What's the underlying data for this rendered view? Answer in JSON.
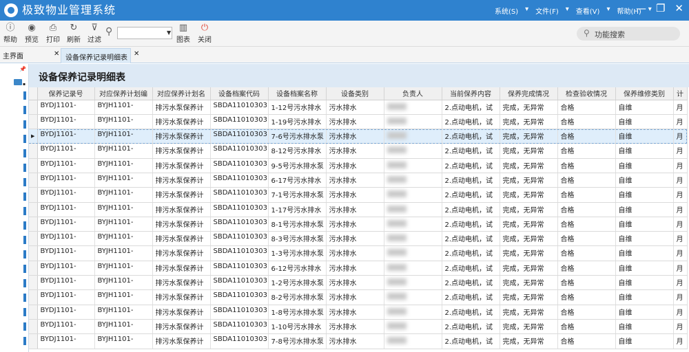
{
  "app": {
    "title": "极致物业管理系统"
  },
  "menu": [
    "系统(S)",
    "文件(F)",
    "查看(V)",
    "帮助(H)"
  ],
  "window_icons": [
    "minimize-icon",
    "restore-icon",
    "close-icon"
  ],
  "toolbar": {
    "help": "帮助",
    "preview": "预览",
    "print": "打印",
    "refresh": "刷新",
    "filter": "过滤",
    "chart": "图表",
    "close": "关闭",
    "search_value": "",
    "function_search": "功能搜索"
  },
  "tabs": {
    "home": "主界面",
    "active": "设备保养记录明细表"
  },
  "page": {
    "heading": "设备保养记录明细表"
  },
  "table": {
    "columns": [
      "保养记录号",
      "对应保养计划编",
      "对应保养计划名",
      "设备档案代码",
      "设备档案名称",
      "设备类别",
      "负责人",
      "当前保养内容",
      "保养完成情况",
      "检查验收情况",
      "保养维修类别",
      "计"
    ],
    "selected_row": 2,
    "rows": [
      [
        "BYDJ1101-",
        "BYJH1101-",
        "排污水泵保养计",
        "SBDA11010303",
        "1-12号污水排水",
        "污水排水",
        "",
        "2.点动电机，试",
        "完成，无异常",
        "合格",
        "自维",
        "月"
      ],
      [
        "BYDJ1101-",
        "BYJH1101-",
        "排污水泵保养计",
        "SBDA11010303",
        "1-19号污水排水",
        "污水排水",
        "",
        "2.点动电机，试",
        "完成，无异常",
        "合格",
        "自维",
        "月"
      ],
      [
        "BYDJ1101-",
        "BYJH1101-",
        "排污水泵保养计",
        "SBDA11010303",
        "7-6号污水排水泵",
        "污水排水",
        "",
        "2.点动电机，试",
        "完成，无异常",
        "合格",
        "自维",
        "月"
      ],
      [
        "BYDJ1101-",
        "BYJH1101-",
        "排污水泵保养计",
        "SBDA11010303",
        "8-12号污水排水",
        "污水排水",
        "",
        "2.点动电机，试",
        "完成，无异常",
        "合格",
        "自维",
        "月"
      ],
      [
        "BYDJ1101-",
        "BYJH1101-",
        "排污水泵保养计",
        "SBDA11010303",
        "9-5号污水排水泵",
        "污水排水",
        "",
        "2.点动电机，试",
        "完成，无异常",
        "合格",
        "自维",
        "月"
      ],
      [
        "BYDJ1101-",
        "BYJH1101-",
        "排污水泵保养计",
        "SBDA11010303",
        "6-17号污水排水",
        "污水排水",
        "",
        "2.点动电机，试",
        "完成，无异常",
        "合格",
        "自维",
        "月"
      ],
      [
        "BYDJ1101-",
        "BYJH1101-",
        "排污水泵保养计",
        "SBDA11010303",
        "7-1号污水排水泵",
        "污水排水",
        "",
        "2.点动电机，试",
        "完成，无异常",
        "合格",
        "自维",
        "月"
      ],
      [
        "BYDJ1101-",
        "BYJH1101-",
        "排污水泵保养计",
        "SBDA11010303",
        "1-17号污水排水",
        "污水排水",
        "",
        "2.点动电机，试",
        "完成，无异常",
        "合格",
        "自维",
        "月"
      ],
      [
        "BYDJ1101-",
        "BYJH1101-",
        "排污水泵保养计",
        "SBDA11010303",
        "8-1号污水排水泵",
        "污水排水",
        "",
        "2.点动电机，试",
        "完成，无异常",
        "合格",
        "自维",
        "月"
      ],
      [
        "BYDJ1101-",
        "BYJH1101-",
        "排污水泵保养计",
        "SBDA11010303",
        "8-3号污水排水泵",
        "污水排水",
        "",
        "2.点动电机，试",
        "完成，无异常",
        "合格",
        "自维",
        "月"
      ],
      [
        "BYDJ1101-",
        "BYJH1101-",
        "排污水泵保养计",
        "SBDA11010303",
        "1-3号污水排水泵",
        "污水排水",
        "",
        "2.点动电机，试",
        "完成，无异常",
        "合格",
        "自维",
        "月"
      ],
      [
        "BYDJ1101-",
        "BYJH1101-",
        "排污水泵保养计",
        "SBDA11010303",
        "6-12号污水排水",
        "污水排水",
        "",
        "2.点动电机，试",
        "完成，无异常",
        "合格",
        "自维",
        "月"
      ],
      [
        "BYDJ1101-",
        "BYJH1101-",
        "排污水泵保养计",
        "SBDA11010303",
        "1-2号污水排水泵",
        "污水排水",
        "",
        "2.点动电机，试",
        "完成，无异常",
        "合格",
        "自维",
        "月"
      ],
      [
        "BYDJ1101-",
        "BYJH1101-",
        "排污水泵保养计",
        "SBDA11010303",
        "8-2号污水排水泵",
        "污水排水",
        "",
        "2.点动电机，试",
        "完成，无异常",
        "合格",
        "自维",
        "月"
      ],
      [
        "BYDJ1101-",
        "BYJH1101-",
        "排污水泵保养计",
        "SBDA11010303",
        "1-8号污水排水泵",
        "污水排水",
        "",
        "2.点动电机，试",
        "完成，无异常",
        "合格",
        "自维",
        "月"
      ],
      [
        "BYDJ1101-",
        "BYJH1101-",
        "排污水泵保养计",
        "SBDA11010303",
        "1-10号污水排水",
        "污水排水",
        "",
        "2.点动电机，试",
        "完成，无异常",
        "合格",
        "自维",
        "月"
      ],
      [
        "BYDJ1101-",
        "BYJH1101-",
        "排污水泵保养计",
        "SBDA11010303",
        "7-8号污水排水泵",
        "污水排水",
        "",
        "2.点动电机，试",
        "完成，无异常",
        "合格",
        "自维",
        "月"
      ]
    ]
  }
}
